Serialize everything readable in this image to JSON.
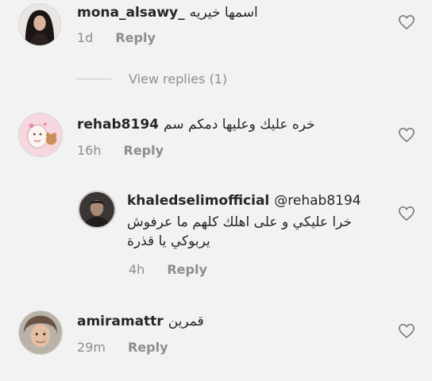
{
  "comments": [
    {
      "username": "mona_alsawy_",
      "text": "اسمها خيريه",
      "time": "1d",
      "reply_label": "Reply",
      "view_replies": "View replies (1)"
    },
    {
      "username": "rehab8194",
      "text": "خره عليك وعليها دمكم سم",
      "time": "16h",
      "reply_label": "Reply"
    },
    {
      "username": "khaledselimofficial",
      "mention": "@rehab8194",
      "text_line1": "خرا عليكي و على اهلك كلهم ما عرفوش",
      "text_line2": "يربوكي يا قذرة",
      "time": "4h",
      "reply_label": "Reply"
    },
    {
      "username": "amiramattr",
      "text": "قمرين",
      "time": "29m",
      "reply_label": "Reply"
    }
  ],
  "icons": {
    "like": "heart-outline-icon"
  },
  "colors": {
    "background": "#f2f2f2",
    "text": "#262626",
    "muted": "#8e8e8e"
  }
}
